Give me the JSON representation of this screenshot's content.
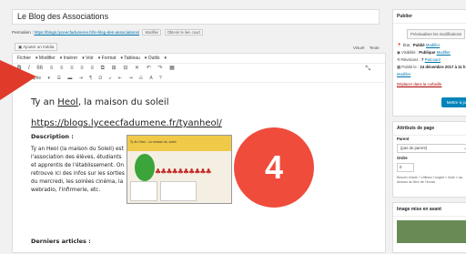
{
  "post": {
    "title": "Le Blog des Associations",
    "permalink_label": "Permalien :",
    "permalink_url": "https://blogs.lyceecfadumene.fr/le-blog-des-associations/",
    "permalink_edit": "Modifier",
    "permalink_short": "Obtenir le lien court"
  },
  "toolbar": {
    "add_media": "Ajouter un média",
    "tab_visual": "Visuel",
    "tab_text": "Texte",
    "menu": [
      "Fichier",
      "Modifier",
      "Insérer",
      "Voir",
      "Format",
      "Tableau",
      "Outils"
    ],
    "row1_icons": [
      "B",
      "I",
      "66",
      "≡",
      "≡",
      "≡",
      "≡",
      "≡",
      "⧉",
      "⊞",
      "⊟",
      "✕",
      "↶",
      "↷",
      "▦"
    ],
    "paragraph_label": "Paragraphe",
    "row2_icons": [
      "☰",
      "▬",
      "⇥",
      "¶",
      "Ω",
      "⤶",
      "⇤",
      "⇥",
      "⎌",
      "A",
      "?"
    ],
    "expand": "⤡"
  },
  "content": {
    "heading_prefix": "Ty an ",
    "heading_link": "Heol",
    "heading_suffix": ", la maison du soleil",
    "site_url": "https://blogs.lyceecfadumene.fr/tyanheol/",
    "description_label": "Description :",
    "description_text": "Ty an Heol (la maison du Soleil) est l'association des élèves, étudiants et apprentis de l'établissement. On retrouve ici des infos sur les sorties du mercredi, les soirées cinéma, la webradio, l'infirmerie, etc.",
    "thumbnail_title": "Ty An Heol - La maison du soleil",
    "last_articles": "Derniers articles :"
  },
  "sidebar": {
    "publish_heading": "Publier",
    "preview_button": "Prévisualiser les modifications",
    "status_label": "État : ",
    "status_value": "Publié",
    "status_link": "Modifier",
    "visibility_label": "Visibilité : ",
    "visibility_value": "Publique",
    "visibility_link": "Modifier",
    "revisions_label": "Révisions : ",
    "revisions_value": "7",
    "revisions_link": "Parcourir",
    "published_on_label": "Publié le : ",
    "published_on_value": "24 décembre 2017 à 11 h",
    "published_on_link": "Modifier",
    "trash_link": "Déplacer dans la corbeille",
    "update_button": "Mettre à jour",
    "attributes_heading": "Attributs de page",
    "parent_label": "Parent",
    "parent_value": "(pas de parent)",
    "order_label": "Ordre",
    "order_value": "0",
    "help_text": "Besoin d'aide ? Utilisez l'onglet « Aide » au-dessus du titre de l'écran.",
    "featured_image_heading": "Image mise en avant"
  },
  "overlay": {
    "step_number": "4"
  },
  "colors": {
    "accent": "#0073aa",
    "publish_button": "#0085ba",
    "step_circle": "#ef4c3c",
    "arrow": "#e03a2a"
  }
}
